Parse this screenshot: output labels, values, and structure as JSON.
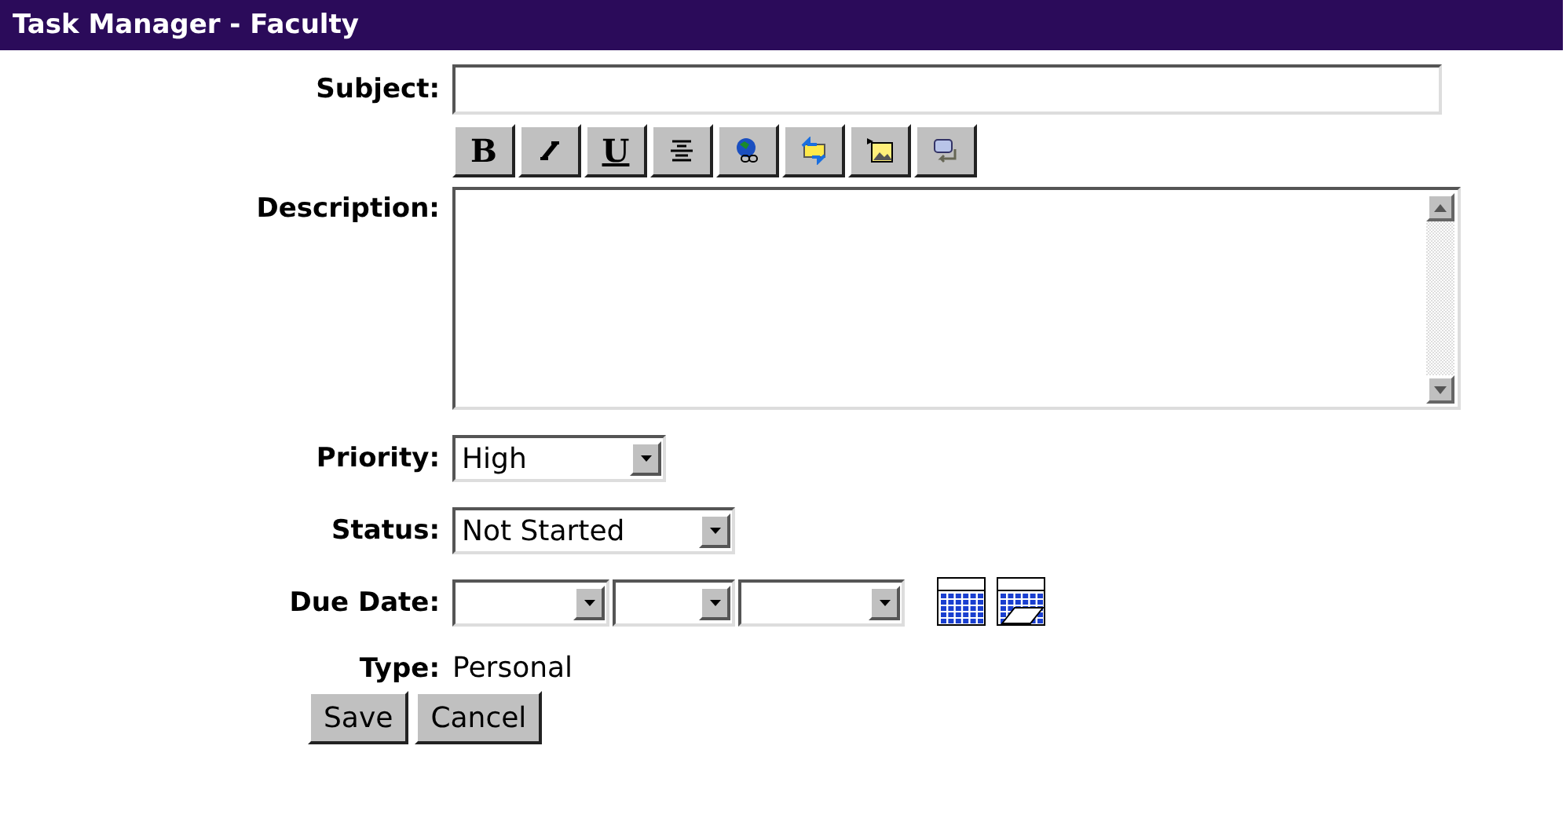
{
  "window": {
    "title": "Task Manager - Faculty"
  },
  "subject": {
    "label": "Subject:"
  },
  "toolbar": [
    {
      "kind": "bold",
      "glyph": "B"
    },
    {
      "kind": "italic"
    },
    {
      "kind": "underline",
      "glyph": "U"
    },
    {
      "kind": "center"
    },
    {
      "kind": "link"
    },
    {
      "kind": "swap"
    },
    {
      "kind": "image"
    },
    {
      "kind": "linebreak"
    }
  ],
  "description": {
    "label": "Description:"
  },
  "priority": {
    "label": "Priority:",
    "value": "High"
  },
  "status": {
    "label": "Status:",
    "value": "Not Started"
  },
  "due_date": {
    "label": "Due Date:"
  },
  "type": {
    "label": "Type:",
    "value": "Personal"
  },
  "buttons": [
    "Save",
    "Cancel"
  ]
}
